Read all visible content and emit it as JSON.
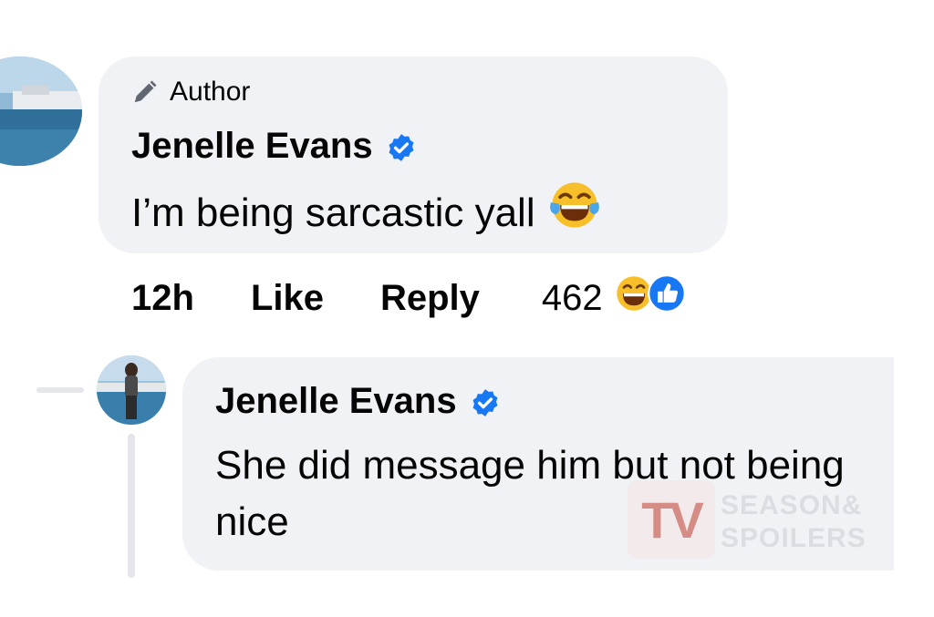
{
  "comment": {
    "badge_label": "Author",
    "author": "Jenelle Evans",
    "text": "I’m being sarcastic yall",
    "time": "12h",
    "like_label": "Like",
    "reply_label": "Reply",
    "reaction_count": "462",
    "reactions": [
      "laughing-emoji",
      "like-emoji"
    ]
  },
  "reply": {
    "author": "Jenelle Evans",
    "text": "She did message him but not being nice"
  },
  "watermark": {
    "logo": "TV",
    "line1": "SEASON&",
    "line2": "SPOILERS"
  },
  "colors": {
    "bubble": "#f0f2f5",
    "verified": "#1877f2",
    "thread_line": "#e4e6eb"
  }
}
